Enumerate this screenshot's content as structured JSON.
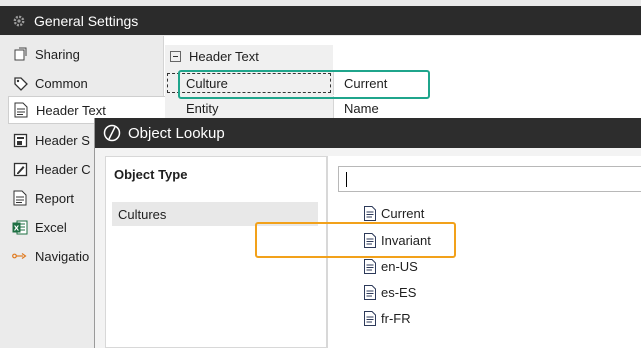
{
  "window": {
    "title": "General Settings"
  },
  "sidebar": {
    "items": [
      {
        "label": "Sharing",
        "icon": "share-icon"
      },
      {
        "label": "Common",
        "icon": "tag-icon"
      },
      {
        "label": "Header Text",
        "icon": "document-icon",
        "active": true
      },
      {
        "label": "Header S",
        "icon": "header-style-icon"
      },
      {
        "label": "Header C",
        "icon": "header-custom-icon"
      },
      {
        "label": "Report",
        "icon": "report-icon"
      },
      {
        "label": "Excel",
        "icon": "excel-icon"
      },
      {
        "label": "Navigatio",
        "icon": "navigation-icon"
      }
    ]
  },
  "property_grid": {
    "section": "Header Text",
    "rows": [
      {
        "name": "Culture",
        "value": "Current"
      },
      {
        "name": "Entity",
        "value": "Name"
      }
    ]
  },
  "dialog": {
    "title": "Object Lookup",
    "object_type_header": "Object Type",
    "object_types": [
      "Cultures"
    ],
    "search": {
      "value": "",
      "placeholder": ""
    },
    "results": [
      "Current",
      "Invariant",
      "en-US",
      "es-ES",
      "fr-FR"
    ]
  },
  "colors": {
    "teal_highlight": "#1fa58c",
    "orange_highlight": "#f2a11a",
    "titlebar": "#2b2b2b"
  }
}
